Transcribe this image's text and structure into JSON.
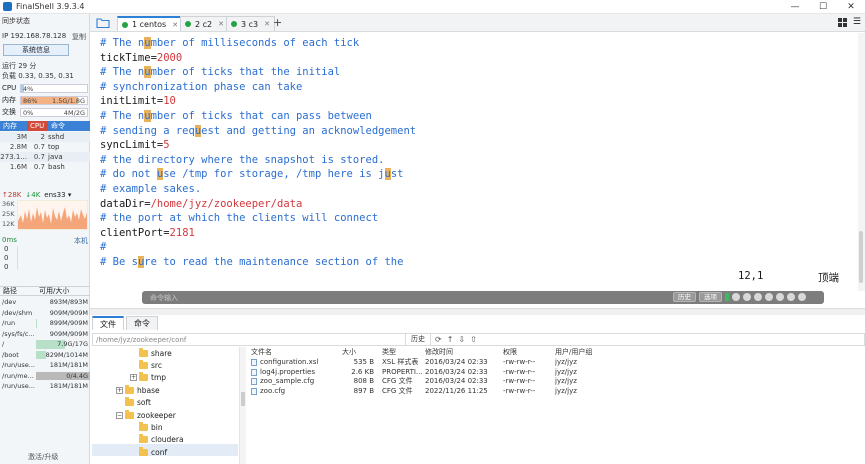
{
  "window": {
    "title": "FinalShell 3.9.3.4",
    "controls": [
      "—",
      "☐",
      "✕"
    ]
  },
  "sidebar": {
    "sync_status": "同步状态",
    "ip": "IP 192.168.78.128",
    "copy_label": "复制",
    "sysinfo_button": "系统信息",
    "uptime": "运行 29 分",
    "load": "负载 0.33, 0.35, 0.31",
    "cpu": {
      "label": "CPU",
      "percent": 4,
      "text": "4%"
    },
    "mem": {
      "label": "内存",
      "percent": 86,
      "text": "86%",
      "value": "1.5G/1.8G"
    },
    "swap": {
      "label": "交换",
      "percent": 0,
      "text": "0%",
      "value": "4M/2G"
    },
    "proc_headers": [
      "内存",
      "CPU",
      "命令"
    ],
    "processes": [
      {
        "mem": "3M",
        "cpu": "2",
        "cmd": "sshd"
      },
      {
        "mem": "2.8M",
        "cpu": "0.7",
        "cmd": "top"
      },
      {
        "mem": "273.1...",
        "cpu": "0.7",
        "cmd": "java"
      },
      {
        "mem": "1.6M",
        "cpu": "0.7",
        "cmd": "bash"
      }
    ],
    "net": {
      "up": "↑28K",
      "down": "↓4K",
      "iface": "ens33",
      "y_labels": [
        "36K",
        "25K",
        "12K"
      ]
    },
    "ping": {
      "label": "0ms",
      "local": "本机",
      "values": [
        "0",
        "0",
        "0"
      ]
    },
    "disk_headers": [
      "路径",
      "可用/大小"
    ],
    "disks": [
      {
        "path": "/dev",
        "size": "893M/893M",
        "used": 0
      },
      {
        "path": "/dev/shm",
        "size": "909M/909M",
        "used": 0
      },
      {
        "path": "/run",
        "size": "899M/909M",
        "used": 0.01
      },
      {
        "path": "/sys/fs/c...",
        "size": "909M/909M",
        "used": 0
      },
      {
        "path": "/",
        "size": "7.9G/17G",
        "used": 0.54
      },
      {
        "path": "/boot",
        "size": "829M/1014M",
        "used": 0.18
      },
      {
        "path": "/run/use...",
        "size": "181M/181M",
        "used": 0
      },
      {
        "path": "/run/me...",
        "size": "0/4.4G",
        "used": 1.0
      },
      {
        "path": "/run/use...",
        "size": "181M/181M",
        "used": 0
      }
    ],
    "upgrade": "激活/升级"
  },
  "tabs": [
    {
      "label": "1 centos",
      "active": true
    },
    {
      "label": "2 c2",
      "active": false
    },
    {
      "label": "3 c3",
      "active": false
    }
  ],
  "terminal": {
    "lines": [
      [
        [
          "c",
          "# The n"
        ],
        [
          "ch",
          "u"
        ],
        [
          "c",
          "mber of milliseconds of each tick"
        ]
      ],
      [
        [
          "k",
          "tickTime="
        ],
        [
          "n",
          "2000"
        ]
      ],
      [
        [
          "c",
          "# The n"
        ],
        [
          "ch",
          "u"
        ],
        [
          "c",
          "mber of ticks that the initial"
        ]
      ],
      [
        [
          "c",
          "# synchronization phase can take"
        ]
      ],
      [
        [
          "k",
          "initLimit="
        ],
        [
          "n",
          "10"
        ]
      ],
      [
        [
          "c",
          "# The n"
        ],
        [
          "ch",
          "u"
        ],
        [
          "c",
          "mber of ticks that can pass between"
        ]
      ],
      [
        [
          "c",
          "# sending a req"
        ],
        [
          "ch",
          "u"
        ],
        [
          "c",
          "est and getting an acknowledgement"
        ]
      ],
      [
        [
          "k",
          "syncLimit="
        ],
        [
          "n",
          "5"
        ]
      ],
      [
        [
          "c",
          "# the directory where the snapshot is stored."
        ]
      ],
      [
        [
          "c",
          "# do not "
        ],
        [
          "ch",
          "u"
        ],
        [
          "c",
          "se /tmp for storage, /tmp here is j"
        ],
        [
          "ch",
          "u"
        ],
        [
          "c",
          "st"
        ]
      ],
      [
        [
          "c",
          "# example sakes."
        ]
      ],
      [
        [
          "k",
          "dataDir="
        ],
        [
          "n",
          "/home/jyz/zookeeper/data"
        ]
      ],
      [
        [
          "c",
          "# the port at which the clients will connect"
        ]
      ],
      [
        [
          "k",
          "clientPort="
        ],
        [
          "n",
          "2181"
        ]
      ],
      [
        [
          "c",
          "#"
        ]
      ],
      [
        [
          "c",
          "# Be s"
        ],
        [
          "ch",
          "u"
        ],
        [
          "c",
          "re to read the maintenance section of the"
        ]
      ]
    ],
    "cursor_pos": "12,1",
    "scroll_pos": "顶端"
  },
  "command_bar": {
    "placeholder": "命令输入",
    "history": "历史",
    "options": "选项"
  },
  "bottom_tabs": [
    "文件",
    "命令"
  ],
  "file_path": "/home/jyz/zookeeper/conf",
  "history_button": "历史",
  "tree": [
    {
      "label": "share",
      "indent": 3,
      "expander": ""
    },
    {
      "label": "src",
      "indent": 3,
      "expander": ""
    },
    {
      "label": "tmp",
      "indent": 3,
      "expander": "+"
    },
    {
      "label": "hbase",
      "indent": 2,
      "expander": "+"
    },
    {
      "label": "soft",
      "indent": 2,
      "expander": ""
    },
    {
      "label": "zookeeper",
      "indent": 2,
      "expander": "−"
    },
    {
      "label": "bin",
      "indent": 3,
      "expander": ""
    },
    {
      "label": "cloudera",
      "indent": 3,
      "expander": ""
    },
    {
      "label": "conf",
      "indent": 3,
      "expander": ""
    }
  ],
  "file_columns": [
    "文件名",
    "大小",
    "类型",
    "修改时间",
    "权限",
    "用户/用户组"
  ],
  "files": [
    {
      "name": "configuration.xsl",
      "size": "535 B",
      "type": "XSL 样式表",
      "date": "2016/03/24 02:33",
      "perm": "-rw-rw-r--",
      "owner": "jyz/jyz"
    },
    {
      "name": "log4j.properties",
      "size": "2.6 KB",
      "type": "PROPERTI...",
      "date": "2016/03/24 02:33",
      "perm": "-rw-rw-r--",
      "owner": "jyz/jyz"
    },
    {
      "name": "zoo_sample.cfg",
      "size": "808 B",
      "type": "CFG 文件",
      "date": "2016/03/24 02:33",
      "perm": "-rw-rw-r--",
      "owner": "jyz/jyz"
    },
    {
      "name": "zoo.cfg",
      "size": "897 B",
      "type": "CFG 文件",
      "date": "2022/11/26 11:25",
      "perm": "-rw-rw-r--",
      "owner": "jyz/jyz"
    }
  ],
  "colors": {
    "accent": "#2e7fd6",
    "comment": "#2b6ed1",
    "value": "#d0383b",
    "highlight": "#e8b15a",
    "mem_bar": "#f4b183"
  }
}
